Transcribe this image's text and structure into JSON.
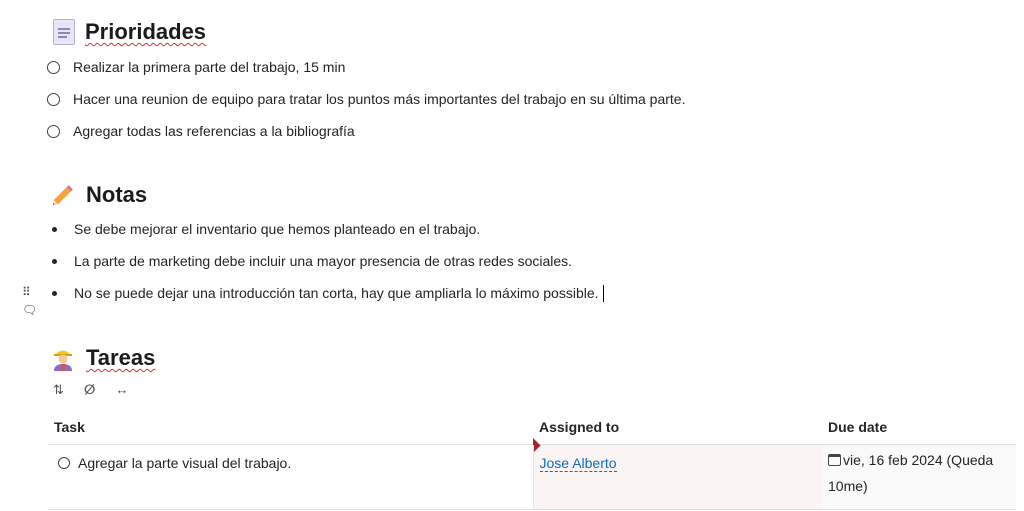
{
  "sections": {
    "prioridades": {
      "title": "Prioridades",
      "items": [
        "Realizar la primera parte del trabajo, 15 min",
        "Hacer una reunion de equipo para tratar los puntos más importantes del trabajo en su última parte.",
        "Agregar todas las referencias a la bibliografía"
      ]
    },
    "notas": {
      "title": "Notas",
      "items": [
        "Se debe mejorar el inventario que hemos planteado en el trabajo.",
        "La parte de marketing debe incluir una mayor presencia de otras redes sociales.",
        "No se puede dejar una introducción tan corta, hay que ampliarla lo máximo possible."
      ]
    },
    "tareas": {
      "title": "Tareas",
      "toolbar": {
        "sort_icon": "⇅",
        "hide_icon": "ⵁ",
        "resize_icon": "↔"
      },
      "columns": [
        "Task",
        "Assigned to",
        "Due date"
      ],
      "rows": [
        {
          "task": "Agregar la parte visual del trabajo.",
          "assigned": "Jose Alberto",
          "due_line1": "vie, 16 feb 2024 (Queda",
          "due_line2": "10me)"
        }
      ]
    }
  },
  "side_icons": {
    "drag": "⠿",
    "comment": "🗨"
  },
  "colors": {
    "spell_underline": "#d13438",
    "person_link": "#0f6cbd",
    "marker": "#a4262c"
  }
}
